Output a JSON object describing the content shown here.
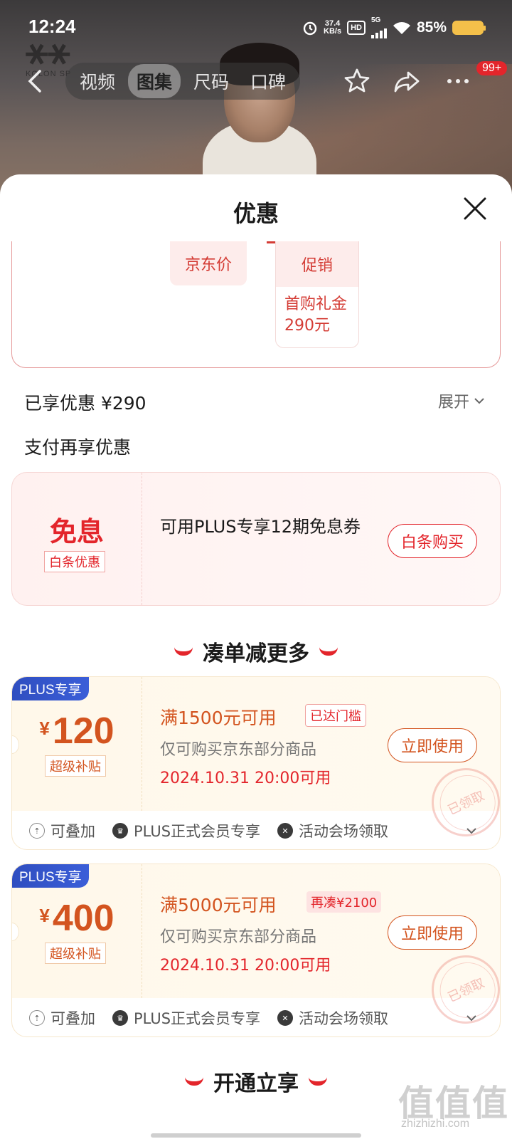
{
  "status_bar": {
    "time": "12:24",
    "net_speed_value": "37.4",
    "net_speed_unit": "KB/s",
    "hd_label": "HD",
    "signal_label": "5G",
    "battery_percent": "85%"
  },
  "hero": {
    "logo_sub": "KOLON SP"
  },
  "navbar": {
    "tabs": [
      {
        "label": "视频",
        "active": false
      },
      {
        "label": "图集",
        "active": true
      },
      {
        "label": "尺码",
        "active": false
      },
      {
        "label": "口碑",
        "active": false
      }
    ],
    "message_badge": "99+"
  },
  "sheet": {
    "title": "优惠",
    "price_card": {
      "jd_price_label": "京东价",
      "promo_label": "促销",
      "promo_detail_line1": "首购礼金",
      "promo_detail_line2": "290元"
    },
    "enjoyed_label": "已享优惠 ¥290",
    "expand_label": "展开",
    "pay_more_label": "支付再享优惠",
    "installment": {
      "big_text": "免息",
      "tag": "白条优惠",
      "desc": "可用PLUS专享12期免息券",
      "button": "白条购买"
    },
    "section_combo": "凑单减更多",
    "coupons": [
      {
        "plus_tag": "PLUS专享",
        "currency": "¥",
        "amount": "120",
        "sub_tag": "超级补贴",
        "condition": "满1500元可用",
        "flag": "已达门槛",
        "flag_type": "reached",
        "scope": "仅可购买京东部分商品",
        "date": "2024.10.31 20:00可用",
        "button": "立即使用",
        "stamp": "已领取",
        "foot": [
          "可叠加",
          "PLUS正式会员专享",
          "活动会场领取"
        ]
      },
      {
        "plus_tag": "PLUS专享",
        "currency": "¥",
        "amount": "400",
        "sub_tag": "超级补贴",
        "condition": "满5000元可用",
        "flag": "再凑¥2100",
        "flag_type": "more",
        "scope": "仅可购买京东部分商品",
        "date": "2024.10.31 20:00可用",
        "button": "立即使用",
        "stamp": "已领取",
        "foot": [
          "可叠加",
          "PLUS正式会员专享",
          "活动会场领取"
        ]
      }
    ],
    "section_open": "开通立享"
  },
  "watermark": {
    "main": "值值值",
    "sub": "zhizhizhi.com"
  },
  "colors": {
    "jd_red": "#e3252b",
    "coupon_orange": "#d3541f",
    "plus_blue": "#2f4ec0"
  }
}
